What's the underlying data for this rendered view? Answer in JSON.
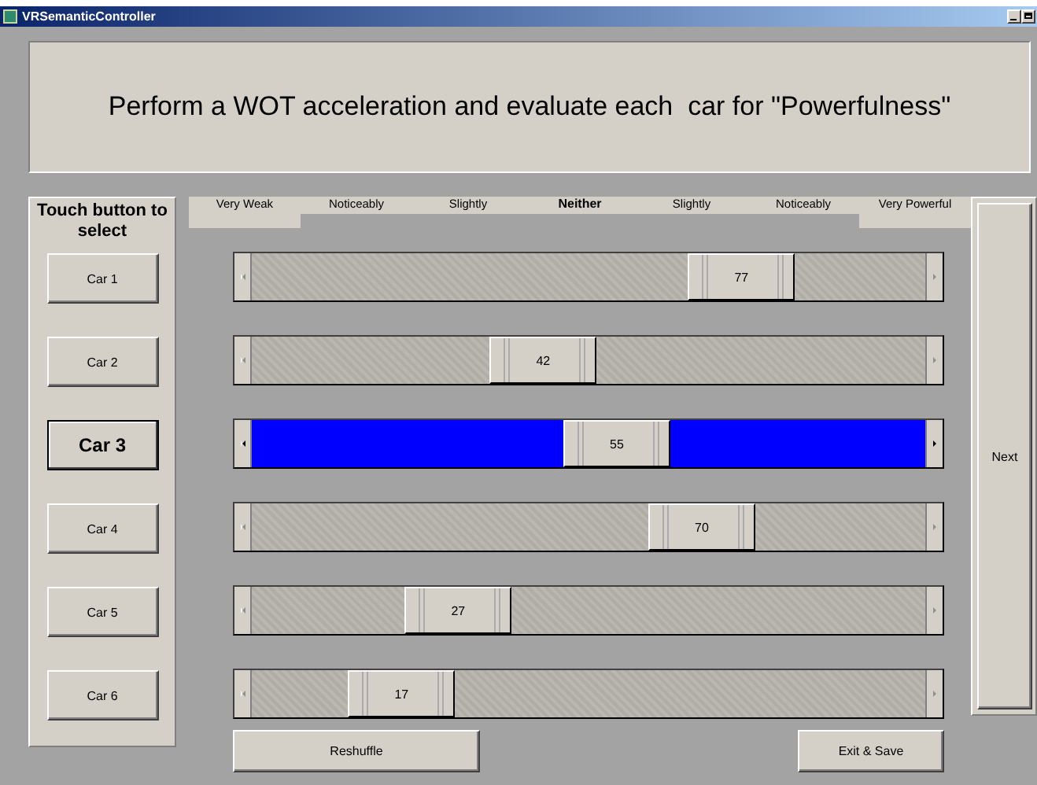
{
  "window": {
    "title": "VRSemanticController"
  },
  "instruction": "Perform a WOT acceleration and evaluate each  car for \"Powerfulness\"",
  "panel_heading": "Touch button to select",
  "scale": [
    {
      "label": "Very Weak",
      "kind": "end"
    },
    {
      "label": "Noticeably",
      "kind": "mid"
    },
    {
      "label": "Slightly",
      "kind": "mid"
    },
    {
      "label": "Neither",
      "kind": "center"
    },
    {
      "label": "Slightly",
      "kind": "mid"
    },
    {
      "label": "Noticeably",
      "kind": "mid"
    },
    {
      "label": "Very Powerful",
      "kind": "end"
    }
  ],
  "cars": [
    {
      "label": "Car 1",
      "selected": false,
      "level": 0.77,
      "reading": "77"
    },
    {
      "label": "Car 2",
      "selected": false,
      "level": 0.42,
      "reading": "42"
    },
    {
      "label": "Car 3",
      "selected": true,
      "level": 0.55,
      "reading": "55"
    },
    {
      "label": "Car 4",
      "selected": false,
      "level": 0.7,
      "reading": "70"
    },
    {
      "label": "Car 5",
      "selected": false,
      "level": 0.27,
      "reading": "27"
    },
    {
      "label": "Car 6",
      "selected": false,
      "level": 0.17,
      "reading": "17"
    }
  ],
  "buttons": {
    "next": "Next",
    "reshuffle": "Reshuffle",
    "exit": "Exit & Save"
  }
}
